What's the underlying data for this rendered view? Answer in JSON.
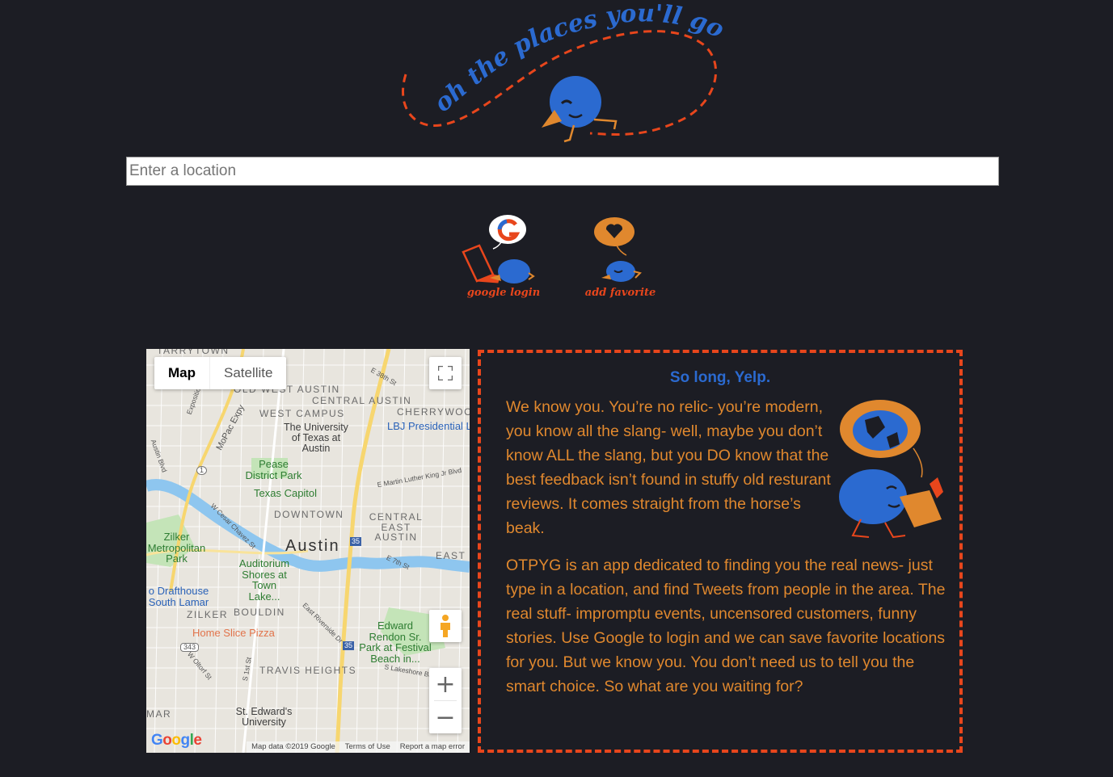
{
  "header": {
    "logo_text": "oh the places you'll go!",
    "icon": "bird-mascot-icon"
  },
  "search": {
    "placeholder": "Enter a location",
    "value": ""
  },
  "actions": {
    "google_login": {
      "label": "google login",
      "icon": "google-bird-laptop-icon"
    },
    "add_favorite": {
      "label": "add favorite",
      "icon": "heart-bird-icon"
    }
  },
  "map": {
    "type_options": [
      "Map",
      "Satellite"
    ],
    "selected_type": "Map",
    "labels": {
      "tarrytown": "TARRYTOWN",
      "old_west_austin": "OLD WEST AUSTIN",
      "central_austin": "CENTRAL AUSTIN",
      "west_campus": "WEST CAMPUS",
      "cherrywood": "CHERRYWOO",
      "ut": "The University of Texas at Austin",
      "lbj": "LBJ Presidential L",
      "pease": "Pease District Park",
      "capitol": "Texas Capitol",
      "downtown": "DOWNTOWN",
      "central_east": "CENTRAL EAST AUSTIN",
      "zilker_park": "Zilker Metropolitan Park",
      "austin": "Austin",
      "auditorium": "Auditorium Shores at Town Lake...",
      "drafthouse": "o Drafthouse South Lamar",
      "east": "EAST",
      "zilker": "ZILKER",
      "bouldin": "BOULDIN",
      "home_slice": "Home Slice Pizza",
      "edward_rendon": "Edward Rendon Sr. Park at Festival Beach in...",
      "travis_heights": "TRAVIS HEIGHTS",
      "mar": "MAR",
      "st_edwards": "St. Edward's University",
      "mopac": "MoPac Expy",
      "e38": "E 38th St",
      "mlk": "E Martin Luther King Jr Blvd",
      "cesar_chavez": "W Cesar Chavez St",
      "e7": "E 7th St",
      "riverside": "East Riverside Dr",
      "lakeshore": "S Lakeshore Blvd",
      "oltorf": "W Oltorf St",
      "s1st": "S 1st St",
      "austin_blvd": "Austin Blvd",
      "exposition": "Exposition",
      "i35_shield": "35",
      "loop1_shield": "1",
      "hwy343_shield": "343"
    },
    "zoom_in": "+",
    "zoom_out": "−",
    "google_mark": "Google",
    "footer": [
      "Map data ©2019 Google",
      "Terms of Use",
      "Report a map error"
    ]
  },
  "about": {
    "title": "So long, Yelp.",
    "paragraph1": "We know you. You’re no relic- you’re modern, you know all the slang- well, maybe you don’t know ALL the slang, but you DO know that the best feedback isn’t found in stuffy old resturant reviews. It comes straight from the horse’s beak.",
    "paragraph2": "OTPYG is an app dedicated to finding you the real news- just type in a location, and find Tweets from people in the area. The real stuff- impromptu events, uncensored customers, funny stories. Use Google to login and we can save favorite locations for you. But we know you. You don’t need us to tell you the smart choice. So what are you waiting for?",
    "illustration": "bird-globe-icon"
  },
  "colors": {
    "background": "#1c1d24",
    "accent_orange": "#e8461c",
    "text_orange": "#e0882e",
    "brand_blue": "#2b6ad0"
  }
}
